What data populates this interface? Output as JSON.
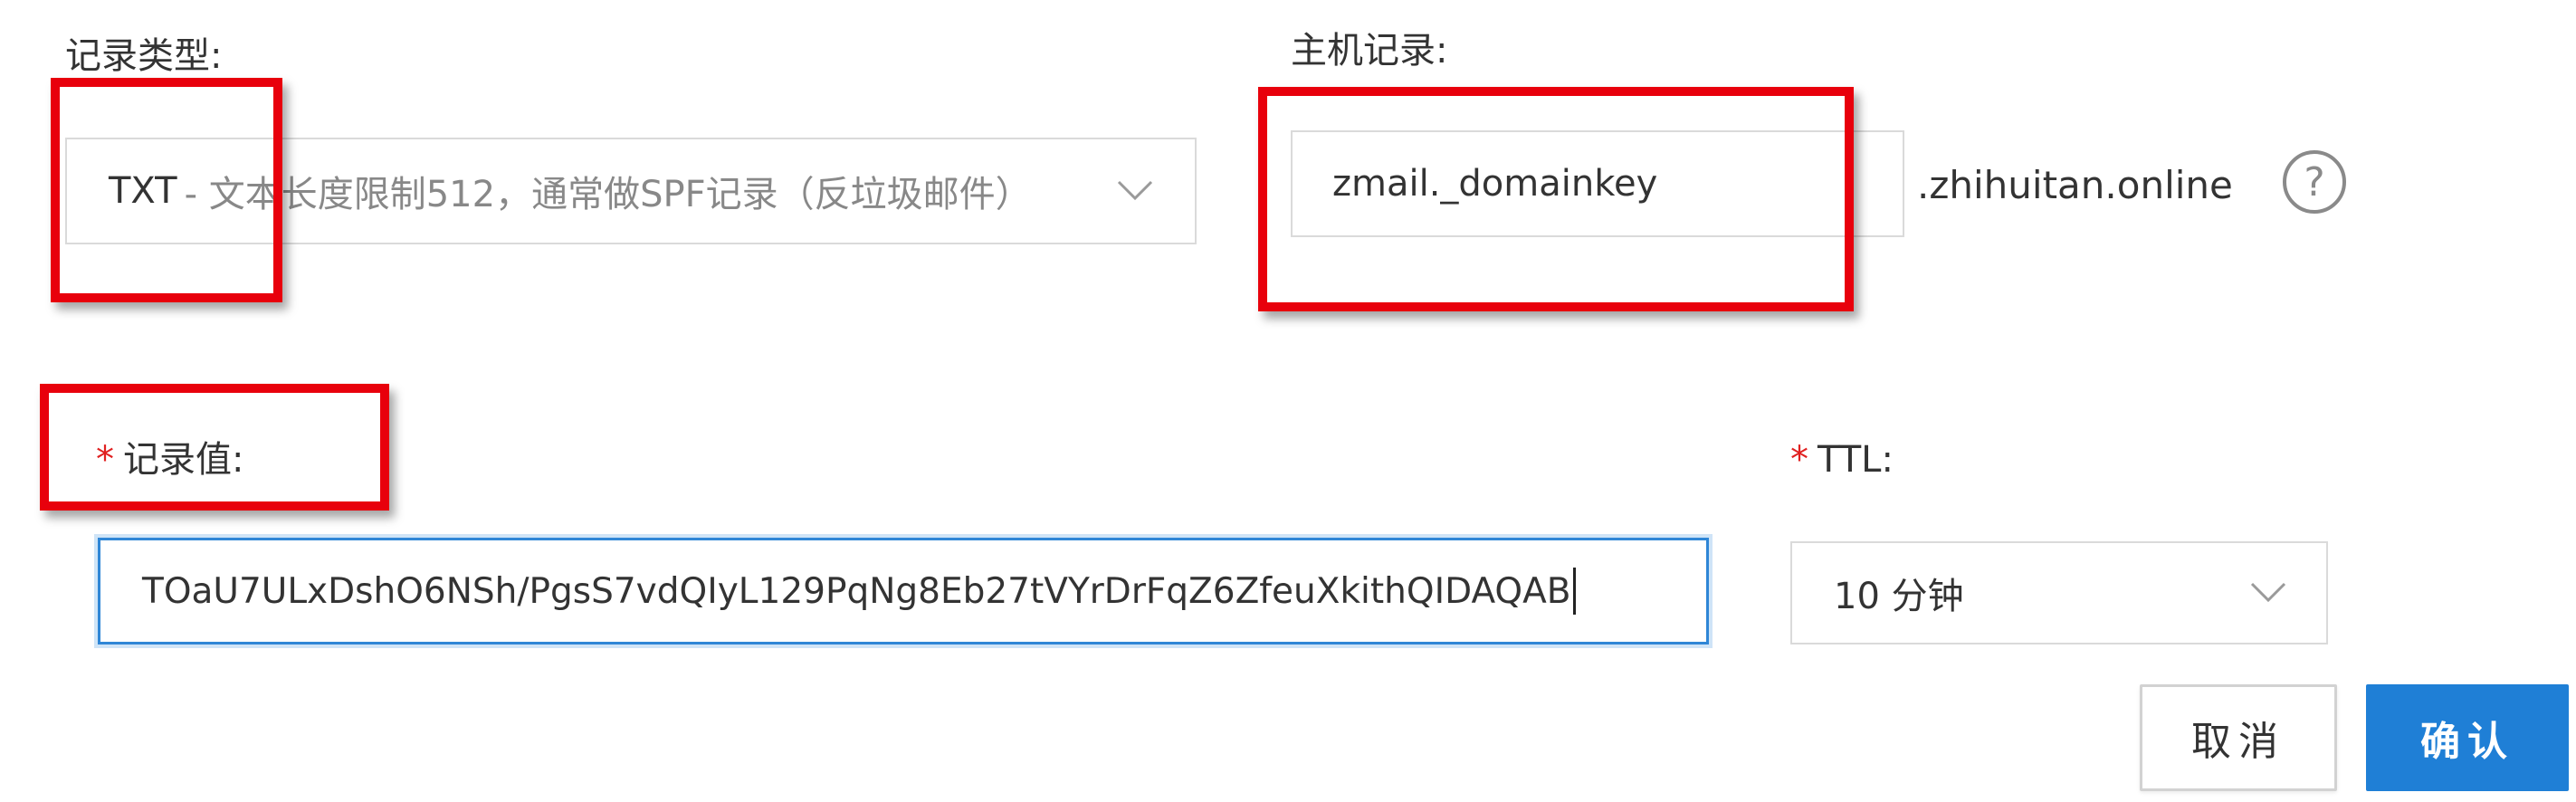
{
  "record_type": {
    "label": "记录类型:",
    "selected_type": "TXT",
    "selected_desc": "- 文本长度限制512，通常做SPF记录（反垃圾邮件）"
  },
  "host_record": {
    "label": "主机记录:",
    "value": "zmail._domainkey",
    "domain_suffix": ".zhihuitan.online",
    "help": "?"
  },
  "record_value": {
    "required_mark": "*",
    "label": "记录值:",
    "value": "TOaU7ULxDshO6NSh/PgsS7vdQIyL129PqNg8Eb27tVYrDrFqZ6ZfeuXkithQIDAQAB"
  },
  "ttl": {
    "required_mark": "*",
    "label": "TTL:",
    "selected": "10 分钟"
  },
  "actions": {
    "cancel": "取消",
    "confirm": "确认"
  },
  "colors": {
    "highlight": "#e8000c",
    "focus": "#2f86d6",
    "primary": "#1f7fd6",
    "required": "#e02020"
  }
}
